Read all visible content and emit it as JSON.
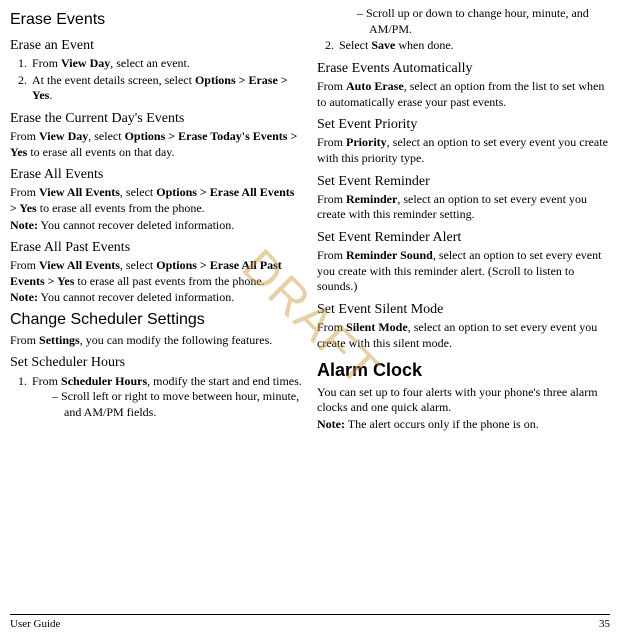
{
  "watermark": "DRAFT",
  "footer": {
    "left": "User Guide",
    "right": "35"
  },
  "left": {
    "h1": "Erase Events",
    "s1": {
      "title": "Erase an Event",
      "step1_pre": "From ",
      "step1_b": "View Day",
      "step1_post": ", select an event.",
      "step2_pre": "At the event details screen, select ",
      "step2_b": "Options > Erase > Yes",
      "step2_post": "."
    },
    "s2": {
      "title": "Erase the Current Day's Events",
      "pre": "From ",
      "b1": "View Day",
      "mid": ", select ",
      "b2": "Options > Erase Today's Events > Yes",
      "post": " to erase all events on that day."
    },
    "s3": {
      "title": "Erase All Events",
      "pre": "From ",
      "b1": "View All Events",
      "mid": ", select ",
      "b2": "Options > Erase All Events > Yes",
      "post": " to erase all events from the phone.",
      "note_b": "Note:",
      "note": " You cannot recover deleted information."
    },
    "s4": {
      "title": "Erase All Past Events",
      "pre": "From ",
      "b1": "View All Events",
      "mid": ", select ",
      "b2": "Options > Erase All Past Events > Yes",
      "post": " to erase all past events from the phone.",
      "note_b": "Note:",
      "note": " You cannot recover deleted information."
    },
    "h2": "Change Scheduler Settings",
    "s5": {
      "pre": "From ",
      "b": "Settings",
      "post": ", you can modify the following features."
    },
    "s6": {
      "title": "Set Scheduler Hours",
      "step1_pre": "From ",
      "step1_b": "Scheduler Hours",
      "step1_post": ", modify the start and end times.",
      "bullet1": "Scroll left or right to move between hour, minute, and AM/PM fields."
    }
  },
  "right": {
    "bullet2": "Scroll up or down to change hour, minute, and AM/PM.",
    "step2_pre": "Select ",
    "step2_b": "Save",
    "step2_post": " when done.",
    "s7": {
      "title": "Erase Events Automatically",
      "pre": "From ",
      "b": "Auto Erase",
      "post": ", select an option from the list to set when to automatically erase your past events."
    },
    "s8": {
      "title": "Set Event Priority",
      "pre": "From ",
      "b": "Priority",
      "post": ", select an option to set every event you create with this priority type."
    },
    "s9": {
      "title": "Set Event Reminder",
      "pre": "From ",
      "b": "Reminder",
      "post": ", select an option to set every event you create with this reminder setting."
    },
    "s10": {
      "title": "Set Event Reminder Alert",
      "pre": "From ",
      "b": "Reminder Sound",
      "post": ", select an option to set every event you create with this reminder alert. (Scroll to listen to sounds.)"
    },
    "s11": {
      "title": "Set Event Silent Mode",
      "pre": "From ",
      "b": "Silent Mode",
      "post": ", select an option to set every event you create with this silent mode."
    },
    "h3": "Alarm Clock",
    "s12": {
      "p": "You can set up to four alerts with your phone's three alarm clocks and one quick alarm.",
      "note_b": "Note:",
      "note": " The alert occurs only if the phone is on."
    }
  }
}
